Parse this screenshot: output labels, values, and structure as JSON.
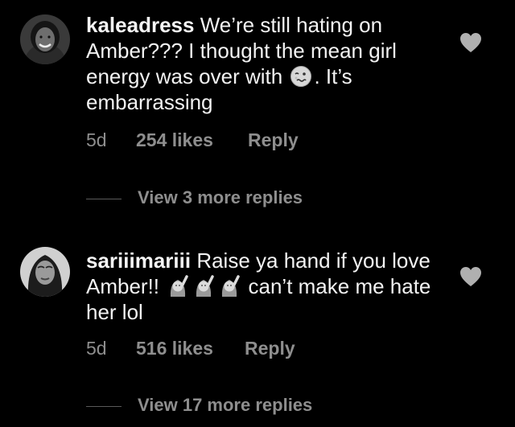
{
  "comments": [
    {
      "username": "kaleadress",
      "text_before_emoji": "We’re still hating on Amber??? I thought the mean girl energy was over with",
      "emoji_icon": "woozy-face-icon",
      "text_after_emoji": ". It’s embarrassing",
      "age": "5d",
      "likes": "254 likes",
      "reply_label": "Reply",
      "view_replies": "View 3 more replies",
      "avatar_icon": "avatar-woman-smiling"
    },
    {
      "username": "sariiimariii",
      "text_before_emoji": "Raise ya hand if you love Amber!!",
      "emoji_icon": "woman-raising-hand-icon",
      "emoji_count": 3,
      "text_after_emoji": "can’t make me hate her lol",
      "age": "5d",
      "likes": "516 likes",
      "reply_label": "Reply",
      "view_replies": "View 17 more replies",
      "avatar_icon": "avatar-woman-long-hair"
    }
  ],
  "colors": {
    "background": "#000000",
    "primary_text": "#f2f2f2",
    "secondary_text": "#8e8e8e",
    "heart": "#b0b0b0"
  }
}
